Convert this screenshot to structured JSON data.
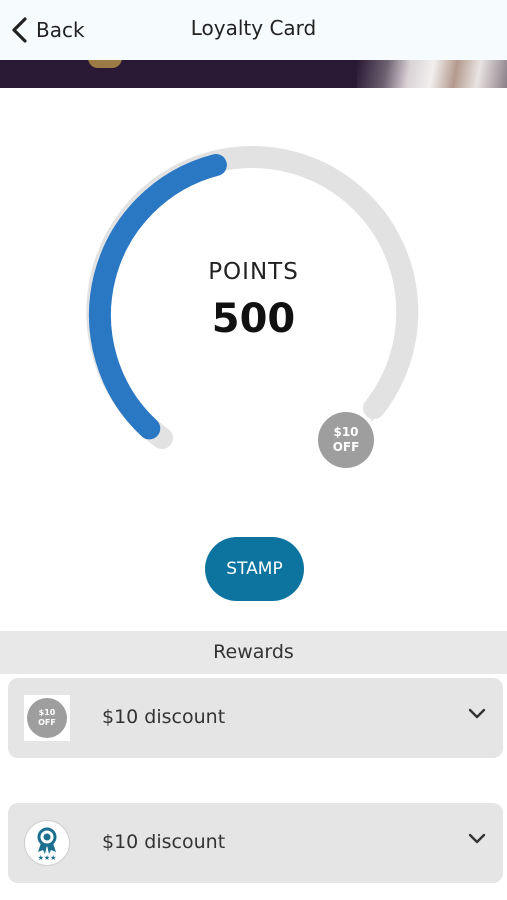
{
  "header": {
    "back_label": "Back",
    "title": "Loyalty Card"
  },
  "gauge": {
    "label": "POINTS",
    "value": "500",
    "progress_fraction": 0.45,
    "progress_color": "#2a78c4",
    "track_color": "#e2e2e2",
    "marker": {
      "line1": "$10",
      "line2": "OFF"
    }
  },
  "stamp_button": {
    "label": "STAMP",
    "color": "#0d74a0"
  },
  "rewards": {
    "title": "Rewards",
    "items": [
      {
        "label": "$10 discount",
        "icon": "coupon-icon",
        "icon_line1": "$10",
        "icon_line2": "OFF"
      },
      {
        "label": "$10 discount",
        "icon": "award-ribbon-icon"
      }
    ]
  }
}
